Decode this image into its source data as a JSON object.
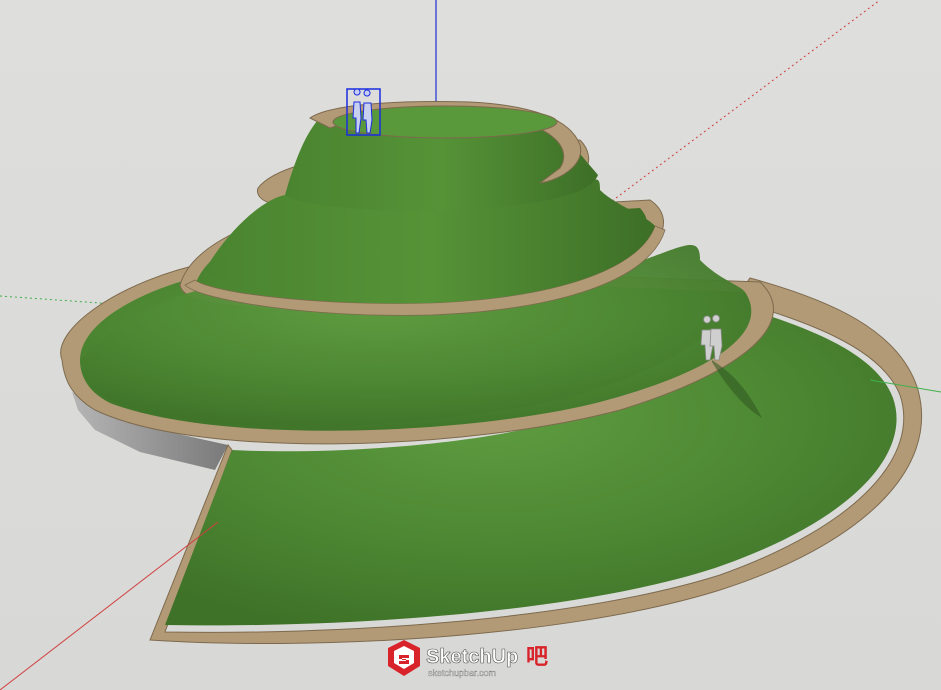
{
  "app": {
    "name": "SketchUp",
    "scene": "spiral-hill-model"
  },
  "watermark": {
    "brand": "SketchUp",
    "suffix": "吧",
    "url": "sketchupbar.com"
  },
  "colors": {
    "background": "#dcdcda",
    "grass": "#4f8a35",
    "grass_dark": "#3b6e28",
    "path": "#b39a76",
    "path_dark": "#8f7a5a",
    "base_wall": "#8d8d8d",
    "axis_red": "#d04040",
    "axis_green": "#3fb04a",
    "axis_blue": "#2030d0",
    "selection": "#1a2de0",
    "brand_red": "#d8232a"
  }
}
